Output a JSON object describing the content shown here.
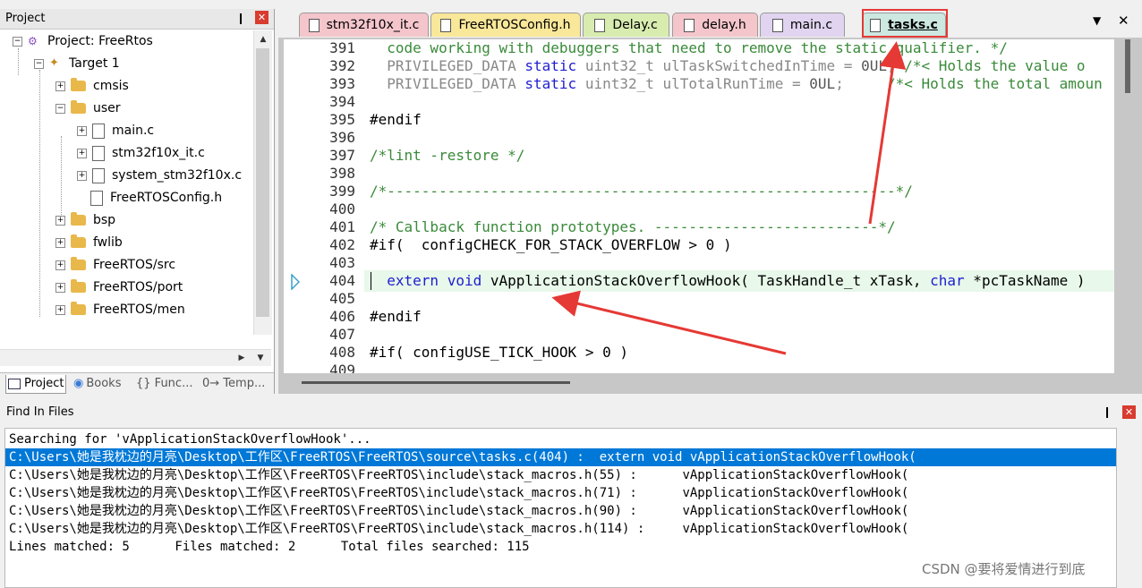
{
  "project_panel": {
    "title": "Project",
    "tree": [
      {
        "label": "Project: FreeRtos",
        "kind": "project"
      },
      {
        "label": "Target 1",
        "kind": "target"
      },
      {
        "label": "cmsis",
        "kind": "folder"
      },
      {
        "label": "user",
        "kind": "folder"
      },
      {
        "label": "main.c",
        "kind": "file"
      },
      {
        "label": "stm32f10x_it.c",
        "kind": "file"
      },
      {
        "label": "system_stm32f10x.c",
        "kind": "file"
      },
      {
        "label": "FreeRTOSConfig.h",
        "kind": "file"
      },
      {
        "label": "bsp",
        "kind": "folder"
      },
      {
        "label": "fwlib",
        "kind": "folder"
      },
      {
        "label": "FreeRTOS/src",
        "kind": "folder"
      },
      {
        "label": "FreeRTOS/port",
        "kind": "folder"
      },
      {
        "label": "FreeRTOS/men",
        "kind": "folder"
      }
    ],
    "bottom_tabs": [
      "Project",
      "Books",
      "{} Func...",
      "0→ Temp..."
    ]
  },
  "editor": {
    "tabs": [
      {
        "label": "stm32f10x_it.c",
        "color": "#f4c6cc"
      },
      {
        "label": "FreeRTOSConfig.h",
        "color": "#f9e79a"
      },
      {
        "label": "Delay.c",
        "color": "#d9ecb0"
      },
      {
        "label": "delay.h",
        "color": "#f4c6cc"
      },
      {
        "label": "main.c",
        "color": "#e0d4f0"
      },
      {
        "label": "tasks.c",
        "color": "#cce8e0"
      }
    ],
    "active_tab": "tasks.c",
    "lines": [
      {
        "n": "391",
        "text": "code working with debuggers that need to remove the static qualifier. */"
      },
      {
        "n": "392",
        "text": "PRIVILEGED_DATA static uint32_t ulTaskSwitchedInTime = 0UL; /*< Holds the value o"
      },
      {
        "n": "393",
        "text": "PRIVILEGED_DATA static uint32_t ulTotalRunTime = 0UL;     /*< Holds the total amoun"
      },
      {
        "n": "394",
        "text": ""
      },
      {
        "n": "395",
        "text": "#endif"
      },
      {
        "n": "396",
        "text": ""
      },
      {
        "n": "397",
        "text": "/*lint -restore */"
      },
      {
        "n": "398",
        "text": ""
      },
      {
        "n": "399",
        "text": "/*-----------------------------------------------------------*/"
      },
      {
        "n": "400",
        "text": ""
      },
      {
        "n": "401",
        "text": "/* Callback function prototypes. --------------------------*/"
      },
      {
        "n": "402",
        "text": "#if(  configCHECK_FOR_STACK_OVERFLOW > 0 )"
      },
      {
        "n": "403",
        "text": ""
      },
      {
        "n": "404",
        "text": "extern void vApplicationStackOverflowHook( TaskHandle_t xTask, char *pcTaskName )"
      },
      {
        "n": "405",
        "text": ""
      },
      {
        "n": "406",
        "text": "#endif"
      },
      {
        "n": "407",
        "text": ""
      },
      {
        "n": "408",
        "text": "#if( configUSE_TICK_HOOK > 0 )"
      },
      {
        "n": "409",
        "text": ""
      }
    ]
  },
  "find_panel": {
    "title": "Find In Files",
    "lines": [
      "Searching for 'vApplicationStackOverflowHook'...",
      "C:\\Users\\她是我枕边的月亮\\Desktop\\工作区\\FreeRTOS\\FreeRTOS\\source\\tasks.c(404) :  extern void vApplicationStackOverflowHook(",
      "C:\\Users\\她是我枕边的月亮\\Desktop\\工作区\\FreeRTOS\\FreeRTOS\\include\\stack_macros.h(55) :      vApplicationStackOverflowHook(",
      "C:\\Users\\她是我枕边的月亮\\Desktop\\工作区\\FreeRTOS\\FreeRTOS\\include\\stack_macros.h(71) :      vApplicationStackOverflowHook(",
      "C:\\Users\\她是我枕边的月亮\\Desktop\\工作区\\FreeRTOS\\FreeRTOS\\include\\stack_macros.h(90) :      vApplicationStackOverflowHook(",
      "C:\\Users\\她是我枕边的月亮\\Desktop\\工作区\\FreeRTOS\\FreeRTOS\\include\\stack_macros.h(114) :     vApplicationStackOverflowHook(",
      "Lines matched: 5      Files matched: 2      Total files searched: 115"
    ]
  },
  "watermark": "CSDN @要将爱情进行到底",
  "accent_colors": {
    "selection": "#0078d7",
    "annotation": "#e53935",
    "current_line": "#e8f8ea"
  }
}
